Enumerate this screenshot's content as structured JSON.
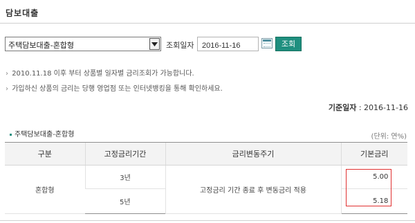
{
  "header": {
    "title": "담보대출"
  },
  "search": {
    "product_selected": "주택담보대출-혼합형",
    "date_label": "조회일자",
    "date_value": "2016-11-16",
    "search_button": "조회"
  },
  "notices": [
    "2010.11.18 이후 부터 상품별 일자별 금리조회가 가능합니다.",
    "가입하신 상품의 금리는 당행 영업점 또는 인터넷뱅킹을 통해 확인하세요."
  ],
  "base_date": {
    "label": "기준일자",
    "value": ": 2016-11-16"
  },
  "section": {
    "title": "주택담보대출-혼합형",
    "unit": "(단위: 연%)"
  },
  "table": {
    "headers": [
      "구분",
      "고정금리기간",
      "금리변동주기",
      "기본금리"
    ],
    "category": "혼합형",
    "change_cycle": "고정금리 기간 종료 후 변동금리 적용",
    "rows": [
      {
        "period": "3년",
        "rate": "5.00"
      },
      {
        "period": "5년",
        "rate": "5.18"
      }
    ]
  },
  "colors": {
    "accent": "#1f8f7f",
    "highlight": "#e03030"
  }
}
